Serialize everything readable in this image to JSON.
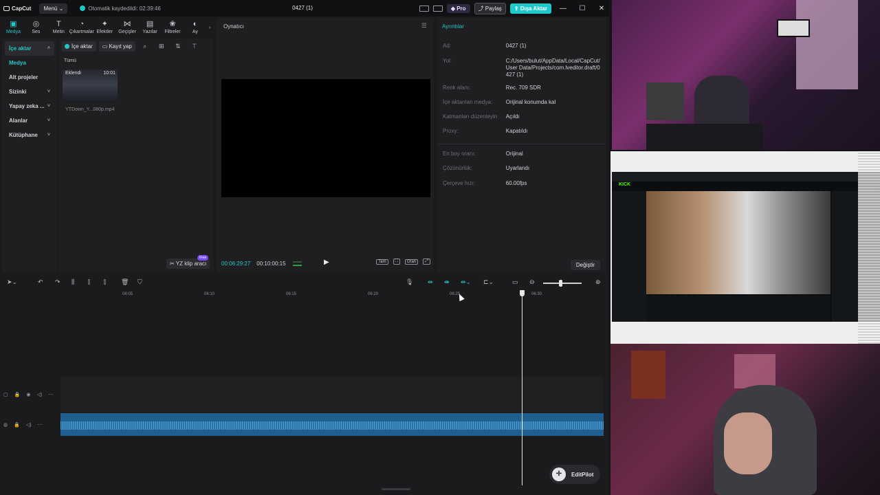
{
  "titlebar": {
    "logo": "CapCut",
    "menu": "Menü",
    "autosave": "Otomatik kaydedildi: 02:39:46",
    "title": "0427 (1)",
    "pro": "Pro",
    "share": "Paylaş",
    "export": "Dışa Aktar"
  },
  "toolbar": {
    "items": [
      {
        "label": "Medya",
        "icon": "media-icon"
      },
      {
        "label": "Ses",
        "icon": "audio-icon"
      },
      {
        "label": "Metin",
        "icon": "text-icon"
      },
      {
        "label": "Çıkartmalar",
        "icon": "sticker-icon"
      },
      {
        "label": "Efektler",
        "icon": "effects-icon"
      },
      {
        "label": "Geçişler",
        "icon": "transitions-icon"
      },
      {
        "label": "Yazılar",
        "icon": "captions-icon"
      },
      {
        "label": "Filtreler",
        "icon": "filters-icon"
      },
      {
        "label": "Ay",
        "icon": "adjust-icon"
      }
    ]
  },
  "left_panel": {
    "items": [
      {
        "label": "İçe aktar"
      },
      {
        "label": "Medya"
      },
      {
        "label": "Alt projeler"
      },
      {
        "label": "Sizinki"
      },
      {
        "label": "Yapay zeka ..."
      },
      {
        "label": "Alanlar"
      },
      {
        "label": "Kütüphane"
      }
    ]
  },
  "media": {
    "import": "İçe aktar",
    "record": "Kayıt yap",
    "filter_all": "Tümü",
    "thumb_label": "Eklendi",
    "thumb_duration": "10:01",
    "thumb_name": "YTDown_Y...080p.mp4",
    "yz_tool": "YZ klip aracı",
    "free_badge": "Free"
  },
  "player": {
    "title": "Oynatıcı",
    "current": "00:06:29:27",
    "total": "00:10:00:15",
    "btn_full": "Tam",
    "btn_ratio": "Oran"
  },
  "details": {
    "title": "Ayrıntılar",
    "rows": [
      {
        "k": "Ad:",
        "v": "0427 (1)"
      },
      {
        "k": "Yol:",
        "v": "C:/Users/bulut/AppData/Local/CapCut/User Data/Projects/com.lveditor.draft/0427 (1)"
      },
      {
        "k": "Renk alanı:",
        "v": "Rec. 709 SDR"
      },
      {
        "k": "İçe aktarılan medya:",
        "v": "Orijinal konumda kal"
      },
      {
        "k": "Katmanları düzenleyin",
        "v": "Açıldı"
      },
      {
        "k": "Proxy:",
        "v": "Kapatıldı"
      },
      {
        "k": "En boy oranı:",
        "v": "Orijinal"
      },
      {
        "k": "Çözünürlük:",
        "v": "Uyarlandı"
      },
      {
        "k": "Çerçeve hızı:",
        "v": "60.00fps"
      }
    ],
    "change": "Değiştir"
  },
  "timeline": {
    "ticks": [
      "06:05",
      "06:10",
      "06:15",
      "06:20",
      "06:25",
      "06:30"
    ]
  },
  "editpilot": "EditPilot",
  "stream": {
    "brand": "KICK"
  },
  "colors": {
    "accent": "#26c6c6",
    "audio_lane": "#1f5f8f",
    "pro": "#2d2740"
  }
}
